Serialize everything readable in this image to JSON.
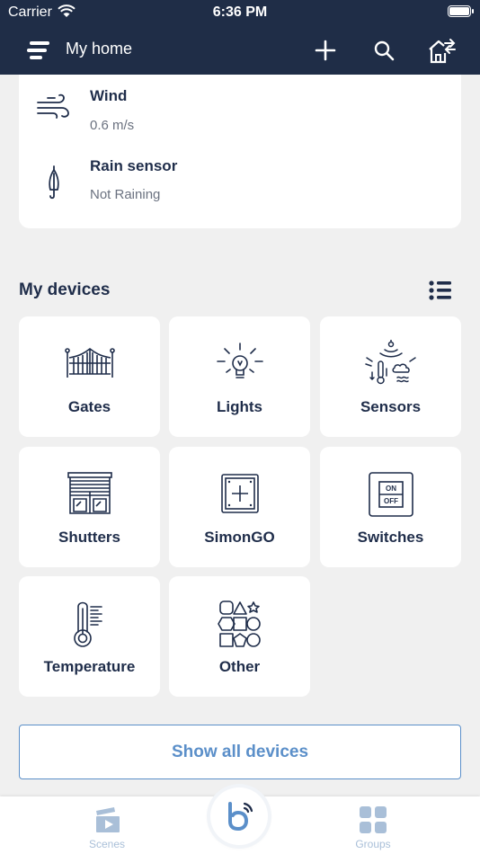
{
  "status_bar": {
    "carrier": "Carrier",
    "time": "6:36 PM"
  },
  "header": {
    "title": "My home",
    "menu_icon": "menu-icon",
    "add_icon": "plus-icon",
    "search_icon": "search-icon",
    "home_icon": "home-switch-icon"
  },
  "weather": {
    "items": [
      {
        "name": "Wind",
        "value": "0.6 m/s",
        "icon": "wind-icon"
      },
      {
        "name": "Rain sensor",
        "value": "Not Raining",
        "icon": "umbrella-icon"
      }
    ]
  },
  "devices": {
    "title": "My devices",
    "view_icon": "list-view-icon",
    "categories": [
      {
        "label": "Gates",
        "icon": "gate-icon"
      },
      {
        "label": "Lights",
        "icon": "light-bulb-icon"
      },
      {
        "label": "Sensors",
        "icon": "sensors-icon"
      },
      {
        "label": "Shutters",
        "icon": "shutter-icon"
      },
      {
        "label": "SimonGO",
        "icon": "simongo-icon"
      },
      {
        "label": "Switches",
        "icon": "switch-icon"
      },
      {
        "label": "Temperature",
        "icon": "thermometer-icon"
      },
      {
        "label": "Other",
        "icon": "shapes-icon"
      }
    ],
    "switch_on": "ON",
    "switch_off": "OFF"
  },
  "show_all_label": "Show all devices",
  "tabbar": {
    "tabs": [
      {
        "label": "Scenes",
        "icon": "scenes-icon"
      },
      {
        "label": "Groups",
        "icon": "groups-icon"
      }
    ],
    "center_icon": "assistant-icon"
  },
  "colors": {
    "nav": "#1f2d47",
    "accent": "#5b8fc9",
    "tab_inactive": "#a9bfd8"
  }
}
